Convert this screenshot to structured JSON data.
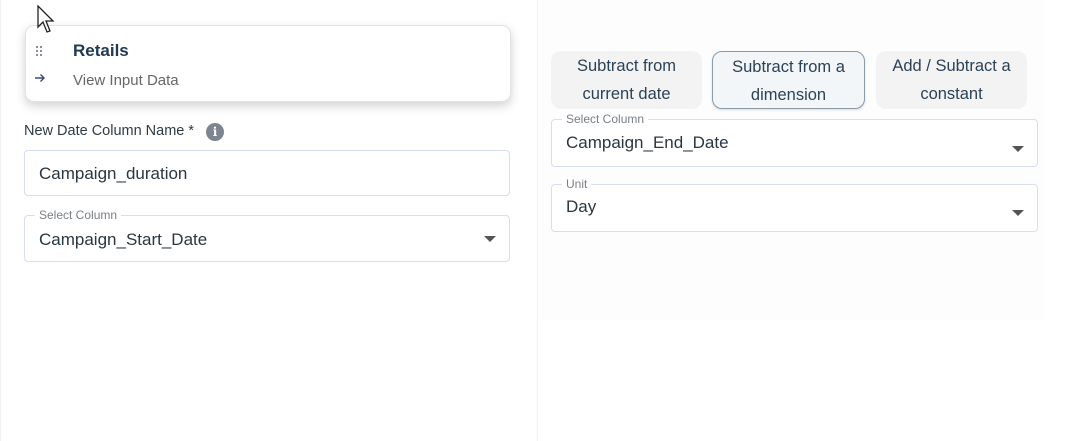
{
  "node": {
    "title": "Retails",
    "link_label": "View Input Data",
    "drag_icon": "drag-handle-icon",
    "arrow_icon": "arrow-right-icon"
  },
  "form": {
    "new_column_label": "New Date Column Name *",
    "new_column_value": "Campaign_duration",
    "select_column_legend": "Select Column",
    "select_column_value": "Campaign_Start_Date"
  },
  "tabs": [
    {
      "label_line1": "Subtract from",
      "label_line2": "current date",
      "active": false
    },
    {
      "label_line1": "Subtract from a",
      "label_line2": "dimension",
      "active": true
    },
    {
      "label_line1": "Add / Subtract a",
      "label_line2": "constant",
      "active": false
    }
  ],
  "right_form": {
    "select_column_legend": "Select Column",
    "select_column_value": "Campaign_End_Date",
    "unit_legend": "Unit",
    "unit_value": "Day"
  },
  "colors": {
    "accent": "#213a52",
    "border": "#d8dcf5",
    "tab_bg": "#f3f3f3",
    "active_tab_border": "#8a9baa"
  }
}
